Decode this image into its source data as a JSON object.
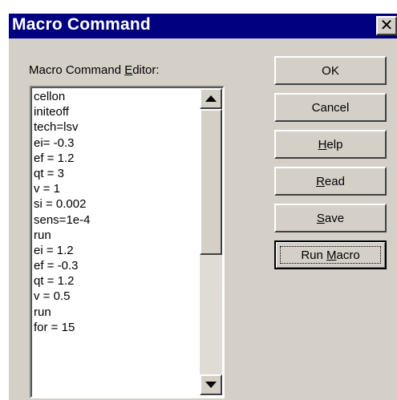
{
  "window": {
    "title": "Macro Command",
    "close_glyph": "✕"
  },
  "editor": {
    "label_pre": "Macro Command ",
    "label_accel": "E",
    "label_post": "ditor:",
    "lines": [
      "cellon",
      "initeoff",
      "tech=lsv",
      "ei= -0.3",
      "ef = 1.2",
      "qt = 3",
      "v = 1",
      "si = 0.002",
      "sens=1e-4",
      "run",
      "ei = 1.2",
      "ef = -0.3",
      "qt = 1.2",
      "v = 0.5",
      "run",
      "for = 15"
    ]
  },
  "buttons": {
    "ok": "OK",
    "cancel": "Cancel",
    "help": "Help",
    "read": "Read",
    "save": "Save",
    "run_macro_pre": "Run ",
    "run_macro_accel": "M",
    "run_macro_post": "acro"
  },
  "icons": {
    "scroll_up": "scroll-up-arrow-icon",
    "scroll_down": "scroll-down-arrow-icon",
    "close": "close-icon"
  }
}
